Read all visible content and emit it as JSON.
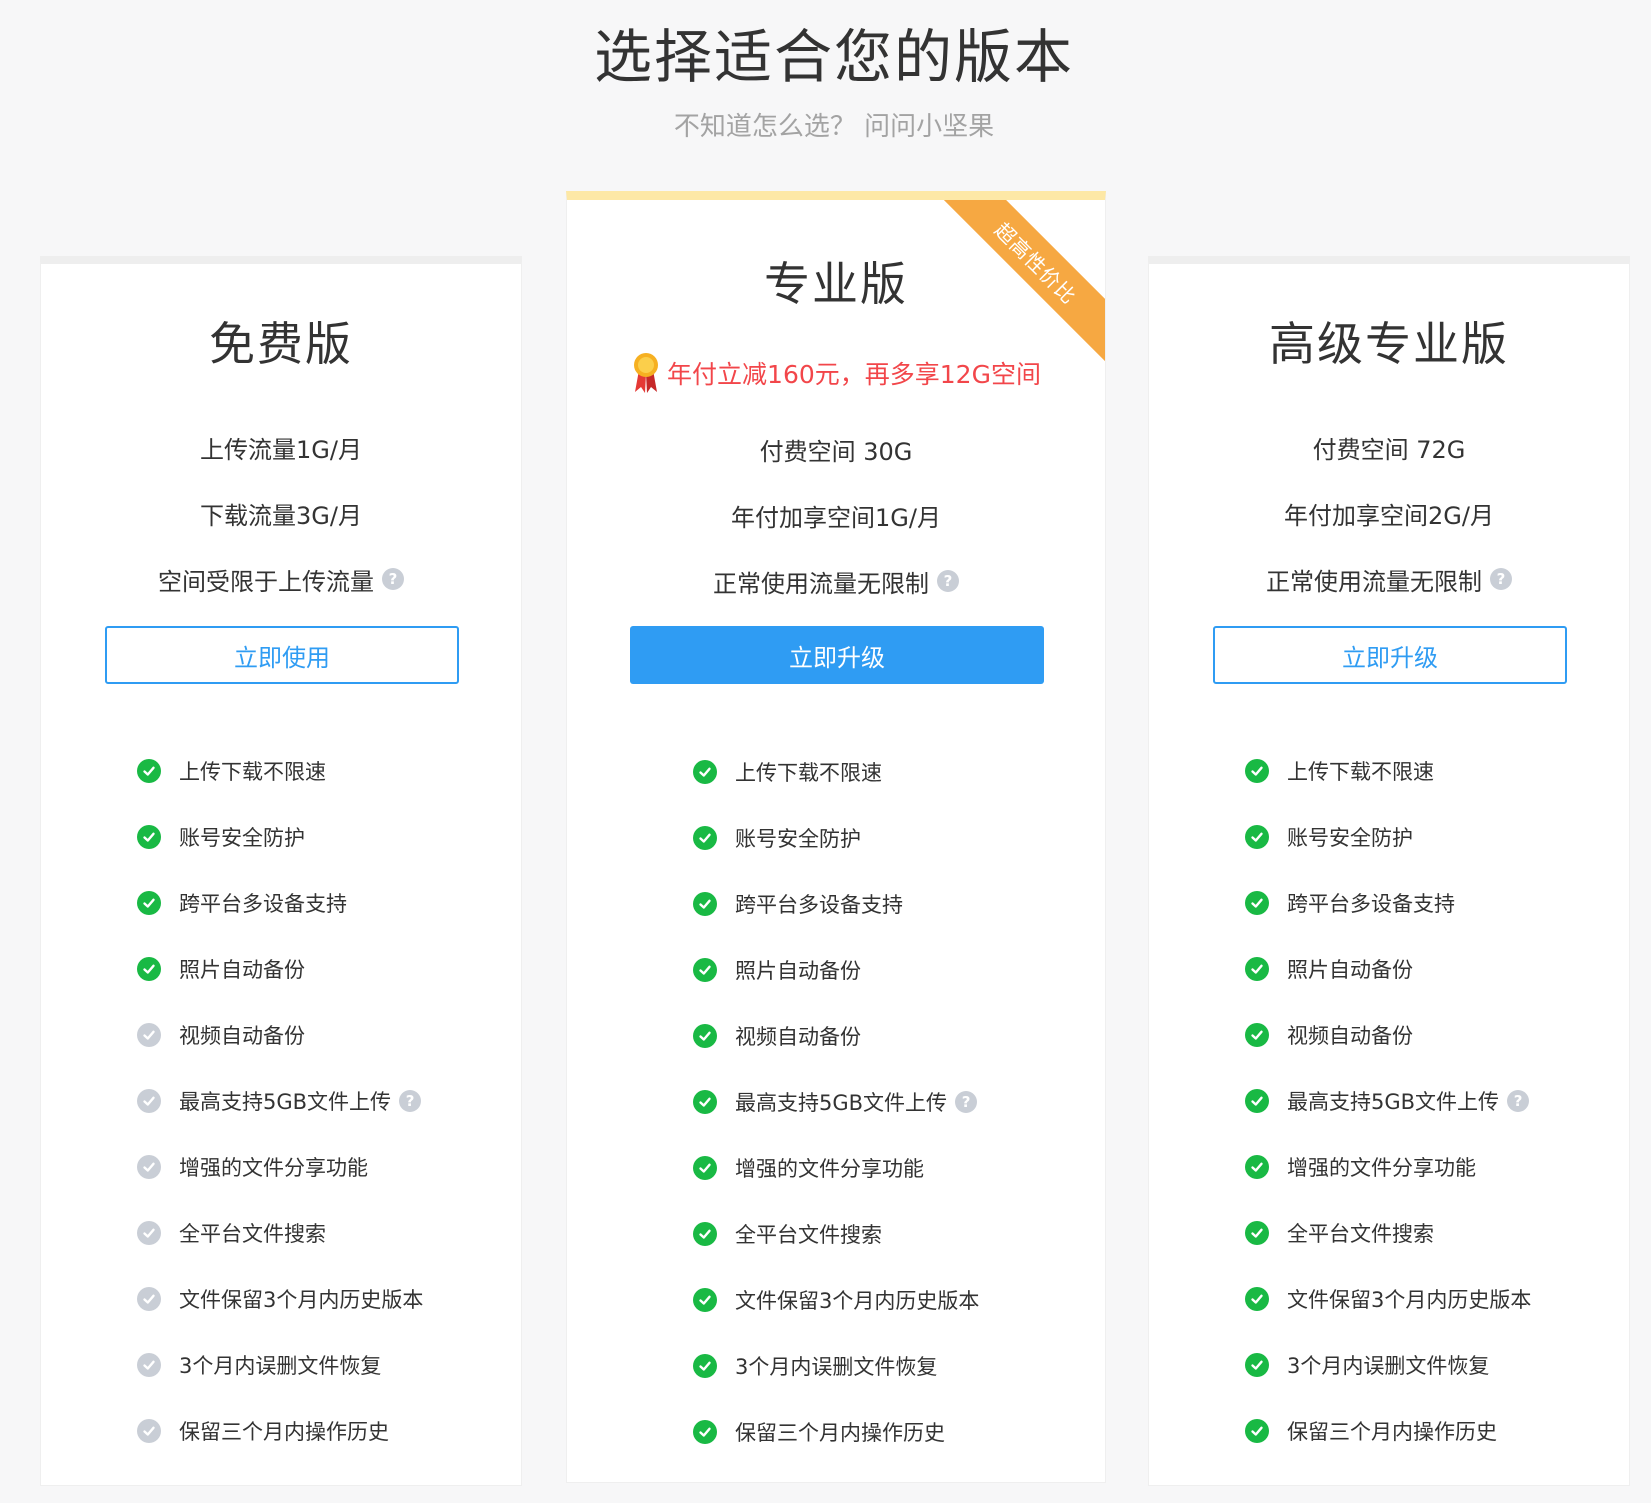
{
  "header": {
    "title": "选择适合您的版本",
    "subtitle": "不知道怎么选？ 问问小坚果"
  },
  "plans": [
    {
      "name": "免费版",
      "specs": [
        "上传流量1G/月",
        "下载流量3G/月",
        "空间受限于上传流量"
      ],
      "button": "立即使用",
      "features": [
        {
          "label": "上传下载不限速",
          "enabled": true
        },
        {
          "label": "账号安全防护",
          "enabled": true
        },
        {
          "label": "跨平台多设备支持",
          "enabled": true
        },
        {
          "label": "照片自动备份",
          "enabled": true
        },
        {
          "label": "视频自动备份",
          "enabled": false
        },
        {
          "label": "最高支持5GB文件上传",
          "enabled": false
        },
        {
          "label": "增强的文件分享功能",
          "enabled": false
        },
        {
          "label": "全平台文件搜索",
          "enabled": false
        },
        {
          "label": "文件保留3个月内历史版本",
          "enabled": false
        },
        {
          "label": "3个月内误删文件恢复",
          "enabled": false
        },
        {
          "label": "保留三个月内操作历史",
          "enabled": false
        }
      ]
    },
    {
      "name": "专业版",
      "ribbon": "超高性价比",
      "promo": "年付立减160元，再多享12G空间",
      "specs": [
        "付费空间 30G",
        "年付加享空间1G/月",
        "正常使用流量无限制"
      ],
      "button": "立即升级",
      "features": [
        {
          "label": "上传下载不限速",
          "enabled": true
        },
        {
          "label": "账号安全防护",
          "enabled": true
        },
        {
          "label": "跨平台多设备支持",
          "enabled": true
        },
        {
          "label": "照片自动备份",
          "enabled": true
        },
        {
          "label": "视频自动备份",
          "enabled": true
        },
        {
          "label": "最高支持5GB文件上传",
          "enabled": true
        },
        {
          "label": "增强的文件分享功能",
          "enabled": true
        },
        {
          "label": "全平台文件搜索",
          "enabled": true
        },
        {
          "label": "文件保留3个月内历史版本",
          "enabled": true
        },
        {
          "label": "3个月内误删文件恢复",
          "enabled": true
        },
        {
          "label": "保留三个月内操作历史",
          "enabled": true
        }
      ]
    },
    {
      "name": "高级专业版",
      "specs": [
        "付费空间 72G",
        "年付加享空间2G/月",
        "正常使用流量无限制"
      ],
      "button": "立即升级",
      "features": [
        {
          "label": "上传下载不限速",
          "enabled": true
        },
        {
          "label": "账号安全防护",
          "enabled": true
        },
        {
          "label": "跨平台多设备支持",
          "enabled": true
        },
        {
          "label": "照片自动备份",
          "enabled": true
        },
        {
          "label": "视频自动备份",
          "enabled": true
        },
        {
          "label": "最高支持5GB文件上传",
          "enabled": true
        },
        {
          "label": "增强的文件分享功能",
          "enabled": true
        },
        {
          "label": "全平台文件搜索",
          "enabled": true
        },
        {
          "label": "文件保留3个月内历史版本",
          "enabled": true
        },
        {
          "label": "3个月内误删文件恢复",
          "enabled": true
        },
        {
          "label": "保留三个月内操作历史",
          "enabled": true
        }
      ]
    }
  ],
  "icons": {
    "help": "question-circle-icon",
    "enabled": "check-circle-icon",
    "disabled": "check-circle-disabled-icon",
    "medal": "medal-icon"
  },
  "colors": {
    "accent": "#2f9cf3",
    "check_on": "#19b944",
    "check_off": "#c9ced6",
    "promo": "#f2464a",
    "ribbon": "#f6a842",
    "pro_top_border": "#fde8a6"
  }
}
